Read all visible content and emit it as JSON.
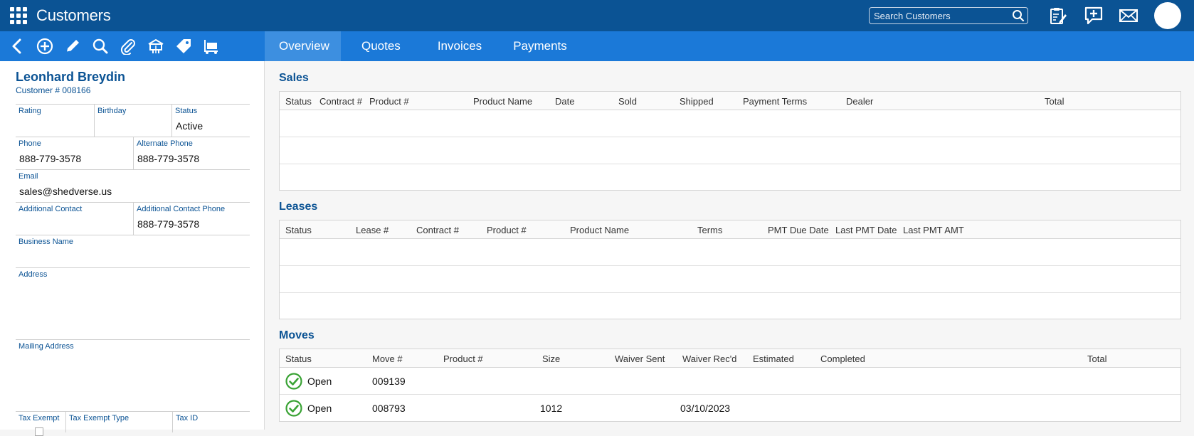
{
  "app": {
    "title": "Customers"
  },
  "search": {
    "placeholder": "Search Customers"
  },
  "tabs": [
    {
      "label": "Overview",
      "active": true
    },
    {
      "label": "Quotes"
    },
    {
      "label": "Invoices"
    },
    {
      "label": "Payments"
    }
  ],
  "customer": {
    "name": "Leonhard Breydin",
    "number": "Customer # 008166",
    "fields": {
      "rating": {
        "label": "Rating",
        "value": ""
      },
      "birthday": {
        "label": "Birthday",
        "value": ""
      },
      "status": {
        "label": "Status",
        "value": "Active"
      },
      "phone": {
        "label": "Phone",
        "value": "888-779-3578"
      },
      "alt_phone": {
        "label": "Alternate Phone",
        "value": "888-779-3578"
      },
      "email": {
        "label": "Email",
        "value": "sales@shedverse.us"
      },
      "additional_contact": {
        "label": "Additional Contact",
        "value": ""
      },
      "additional_contact_phone": {
        "label": "Additional Contact Phone",
        "value": "888-779-3578"
      },
      "business_name": {
        "label": "Business Name",
        "value": ""
      },
      "address": {
        "label": "Address",
        "value": ""
      },
      "mailing_address": {
        "label": "Mailing Address",
        "value": ""
      },
      "tax_exempt": {
        "label": "Tax Exempt"
      },
      "tax_exempt_type": {
        "label": "Tax Exempt Type",
        "value": ""
      },
      "tax_id": {
        "label": "Tax ID",
        "value": ""
      }
    }
  },
  "sales": {
    "title": "Sales",
    "columns": [
      "Status",
      "Contract #",
      "Product #",
      "Product Name",
      "Date",
      "Sold",
      "Shipped",
      "Payment Terms",
      "Dealer",
      "Total"
    ]
  },
  "leases": {
    "title": "Leases",
    "columns": [
      "Status",
      "Lease #",
      "Contract #",
      "Product #",
      "Product Name",
      "Terms",
      "PMT Due Date",
      "Last PMT Date",
      "Last PMT AMT"
    ]
  },
  "moves": {
    "title": "Moves",
    "columns": [
      "Status",
      "Move #",
      "Product #",
      "Size",
      "Waiver Sent",
      "Waiver Rec'd",
      "Estimated",
      "Completed",
      "Total"
    ],
    "rows": [
      {
        "status": "Open",
        "move_no": "009139",
        "product_no": "",
        "size": "",
        "waiver_sent": "",
        "waiver_recd": "",
        "estimated": "",
        "completed": "",
        "total": ""
      },
      {
        "status": "Open",
        "move_no": "008793",
        "product_no": "",
        "size": "1012",
        "waiver_sent": "",
        "waiver_recd": "03/10/2023",
        "estimated": "",
        "completed": "",
        "total": ""
      }
    ]
  },
  "colors": {
    "topbar": "#0b5394",
    "toolbar": "#1b79d8",
    "tab_active": "#3d8fe0",
    "heading": "#0b5394",
    "status_ok": "#3aa335"
  },
  "icons": {
    "toolbar": [
      "back-icon",
      "add-icon",
      "edit-icon",
      "search-icon",
      "attach-icon",
      "shed-move-icon",
      "tag-icon",
      "dolly-icon"
    ],
    "top": [
      "apps-icon",
      "clipboard-edit-icon",
      "add-comment-icon",
      "mail-icon"
    ]
  }
}
